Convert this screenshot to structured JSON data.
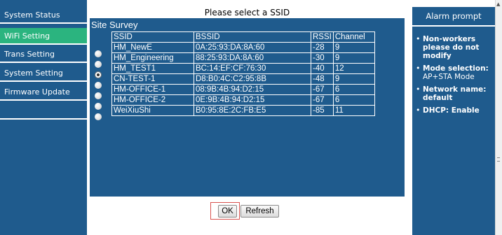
{
  "sidebar": {
    "items": [
      {
        "label": "System Status",
        "active": false
      },
      {
        "label": "WiFi Setting",
        "active": true
      },
      {
        "label": "Trans Setting",
        "active": false
      },
      {
        "label": "System Setting",
        "active": false
      },
      {
        "label": "Firmware Update",
        "active": false
      }
    ]
  },
  "main": {
    "header": "Please select a SSID",
    "section_title": "Site Survey",
    "columns": [
      "SSID",
      "BSSID",
      "RSSI",
      "Channel"
    ],
    "rows": [
      {
        "ssid": "HM_NewE",
        "bssid": "0A:25:93:DA:8A:60",
        "rssi": "-28",
        "channel": "9",
        "selected": false
      },
      {
        "ssid": "HM_Engineering",
        "bssid": "88:25:93:DA:8A:60",
        "rssi": "-30",
        "channel": "9",
        "selected": false
      },
      {
        "ssid": "HM_TEST1",
        "bssid": "BC:14:EF:CF:76:30",
        "rssi": "-40",
        "channel": "12",
        "selected": true
      },
      {
        "ssid": "CN-TEST-1",
        "bssid": "D8:B0:4C:C2:95:8B",
        "rssi": "-48",
        "channel": "9",
        "selected": false
      },
      {
        "ssid": "HM-OFFICE-1",
        "bssid": "08:9B:4B:94:D2:15",
        "rssi": "-67",
        "channel": "6",
        "selected": false
      },
      {
        "ssid": "HM-OFFICE-2",
        "bssid": "0E:9B:4B:94:D2:15",
        "rssi": "-67",
        "channel": "6",
        "selected": false
      },
      {
        "ssid": "WeiXiuShi",
        "bssid": "B0:95:8E:2C:FB:E5",
        "rssi": "-85",
        "channel": "11",
        "selected": false
      }
    ],
    "buttons": {
      "ok": "OK",
      "refresh": "Refresh"
    }
  },
  "alarm": {
    "title": "Alarm prompt",
    "items": [
      {
        "bold": "Non-workers please do not modify",
        "normal": ""
      },
      {
        "bold": "Mode selection:",
        "normal": "AP+STA Mode"
      },
      {
        "bold": "Network name:",
        "normal": "default"
      },
      {
        "bold": "DHCP: Enable",
        "normal": ""
      }
    ]
  },
  "colors": {
    "panel_blue": "#1f5b8d",
    "active_green": "#2bb47f",
    "highlight_red": "#d9534f"
  }
}
